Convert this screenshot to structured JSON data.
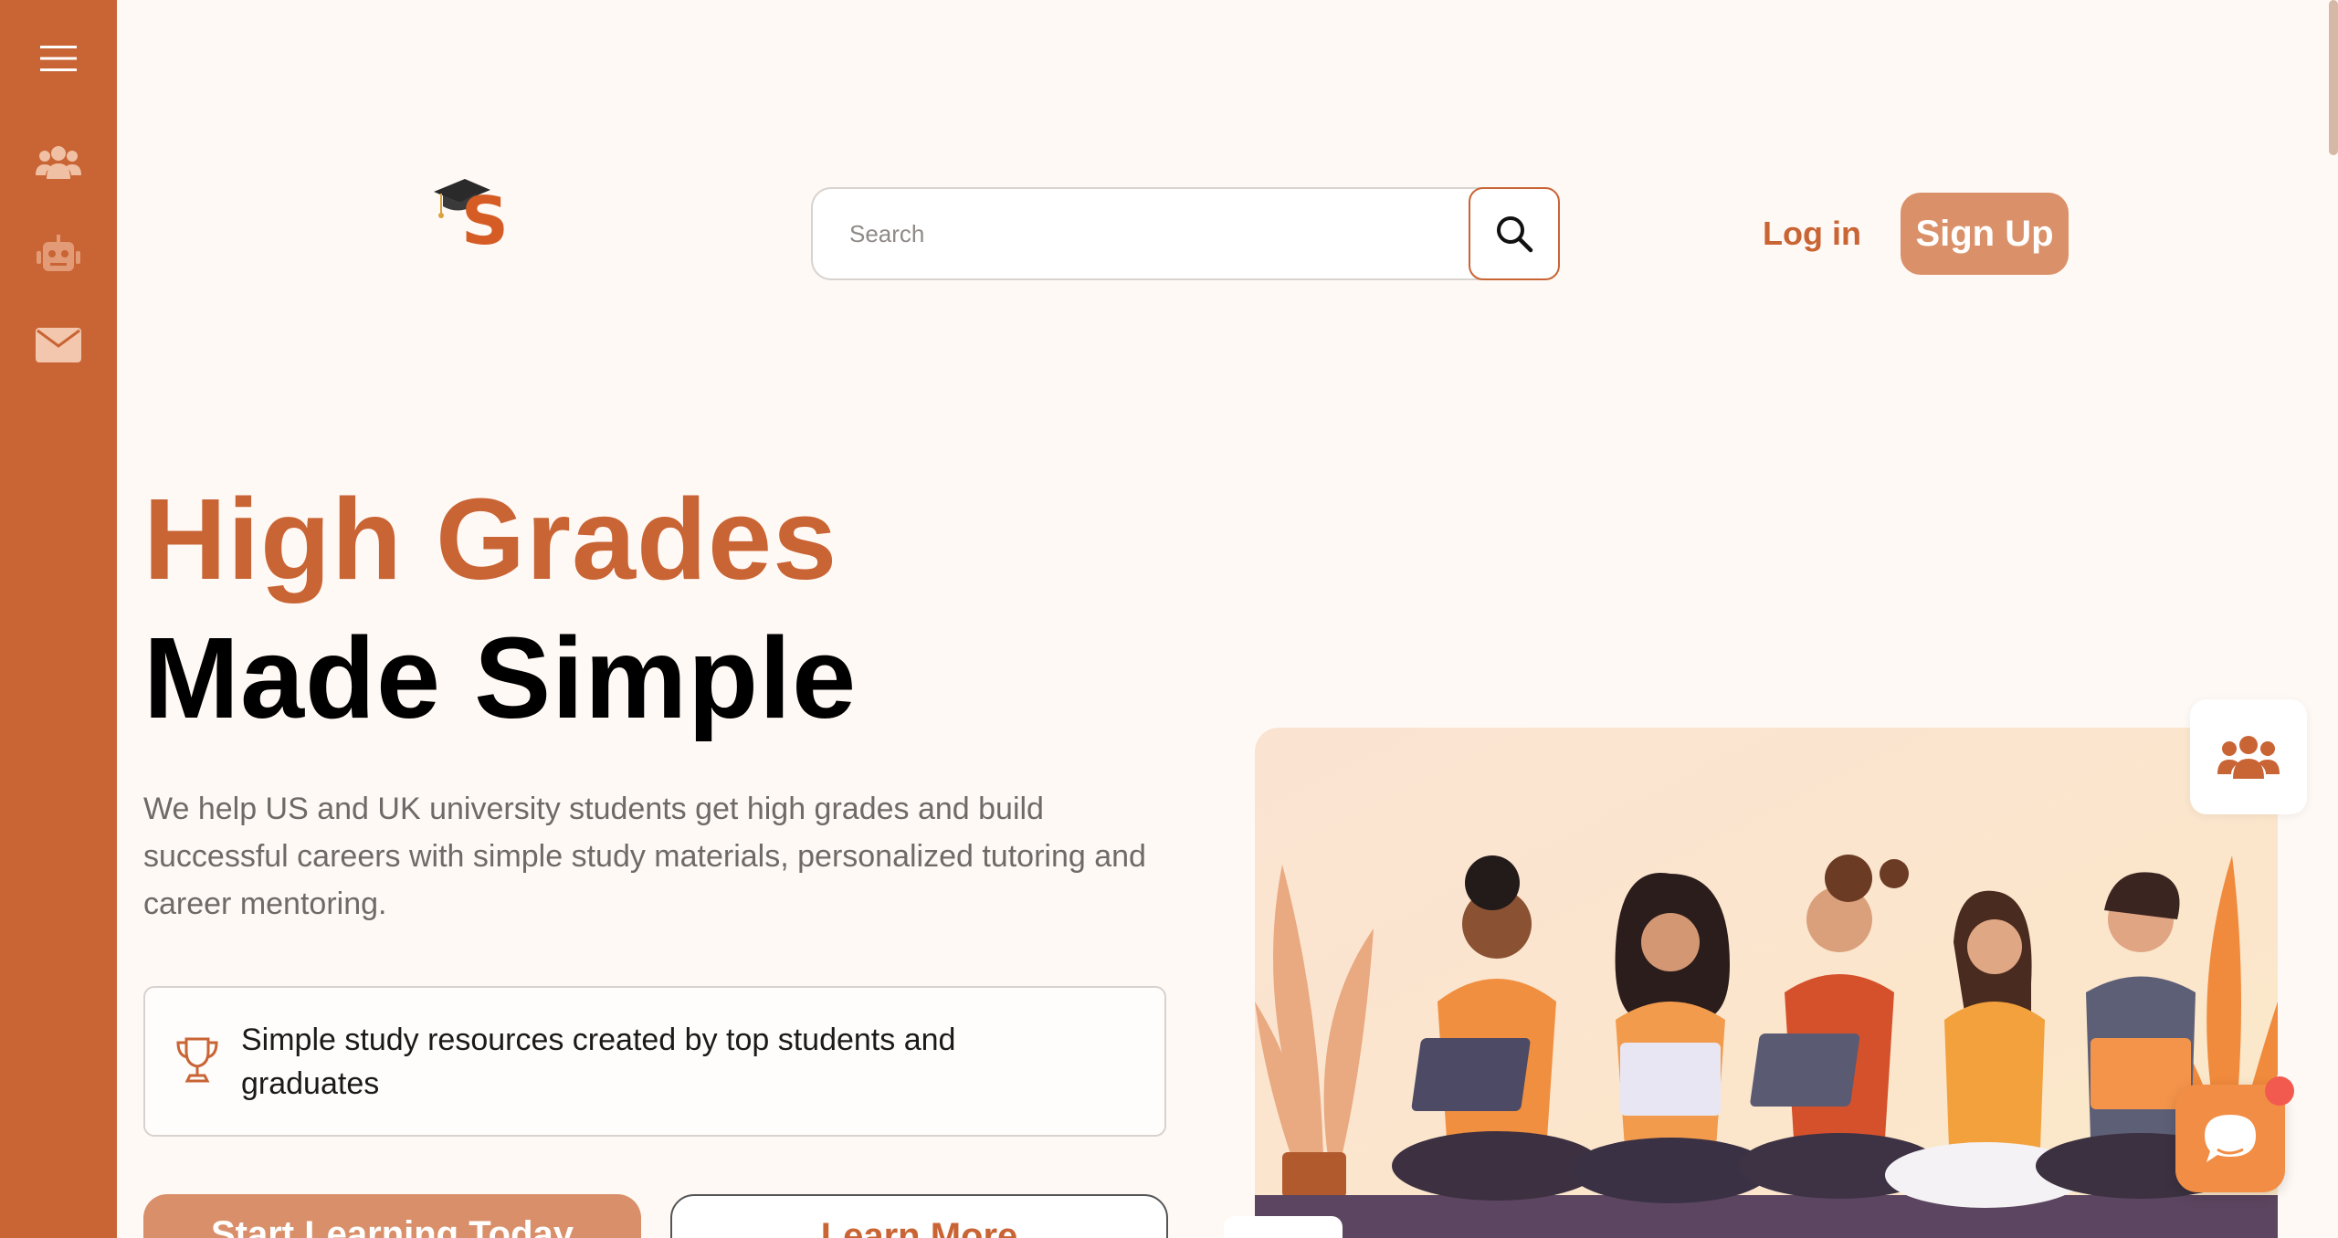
{
  "sidebar": {
    "items": [
      {
        "icon": "menu-icon"
      },
      {
        "icon": "users-icon"
      },
      {
        "icon": "robot-icon"
      },
      {
        "icon": "mail-icon"
      }
    ]
  },
  "header": {
    "logo_letter": "S",
    "search_placeholder": "Search",
    "login_label": "Log in",
    "signup_label": "Sign Up"
  },
  "hero": {
    "title_line1": "High Grades",
    "title_line2": "Made Simple",
    "description": "We help US and UK university students get high grades and build successful careers with simple study materials, personalized tutoring and career mentoring.",
    "feature": "Simple study resources created by top students and graduates",
    "start_button": "Start Learning Today",
    "learn_button": "Learn More"
  },
  "colors": {
    "brand": "#c96434",
    "brand_light": "#d9906a",
    "background": "#fff9f5",
    "chat": "#f28d45"
  }
}
